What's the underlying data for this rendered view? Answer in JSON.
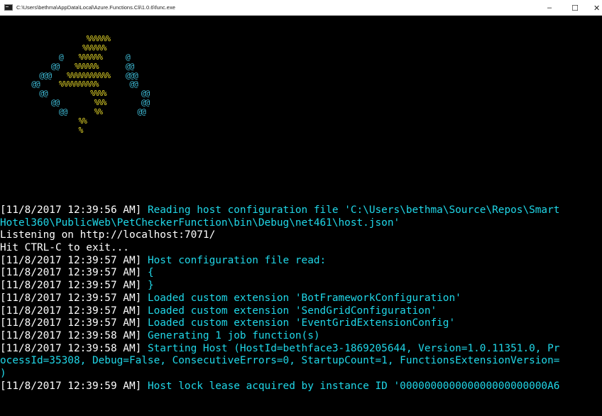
{
  "window": {
    "title": "C:\\Users\\bethma\\AppData\\Local\\Azure.Functions.Cli\\1.0.6\\func.exe",
    "minimize_glyph": "–",
    "maximize_glyph": "☐",
    "close_glyph": "✕"
  },
  "logo": [
    {
      "pad": "                      ",
      "at_left": "",
      "gap": "",
      "pct": "%%%%%%",
      "gap2": "",
      "at_right": ""
    },
    {
      "pad": "                     ",
      "at_left": "",
      "gap": "",
      "pct": "%%%%%%",
      "gap2": "",
      "at_right": ""
    },
    {
      "pad": "               ",
      "at_left": "@",
      "gap": "    ",
      "pct": "%%%%%%",
      "gap2": "      ",
      "at_right": "@"
    },
    {
      "pad": "             ",
      "at_left": "@@",
      "gap": "    ",
      "pct": "%%%%%%",
      "gap2": "       ",
      "at_right": "@@"
    },
    {
      "pad": "          ",
      "at_left": "@@@",
      "gap": "    ",
      "pct": "%%%%%%%%%%%",
      "gap2": "    ",
      "at_right": "@@@"
    },
    {
      "pad": "        ",
      "at_left": "@@",
      "gap": "     ",
      "pct": "%%%%%%%%%%",
      "gap2": "        ",
      "at_right": "@@"
    },
    {
      "pad": "          ",
      "at_left": "@@",
      "gap": "           ",
      "pct": "%%%%",
      "gap2": "         ",
      "at_right": "@@"
    },
    {
      "pad": "             ",
      "at_left": "@@",
      "gap": "         ",
      "pct": "%%%",
      "gap2": "         ",
      "at_right": "@@"
    },
    {
      "pad": "               ",
      "at_left": "@@",
      "gap": "       ",
      "pct": "%%",
      "gap2": "         ",
      "at_right": "@@"
    },
    {
      "pad": "                    ",
      "at_left": "",
      "gap": "",
      "pct": "%%",
      "gap2": "",
      "at_right": ""
    },
    {
      "pad": "                    ",
      "at_left": "",
      "gap": "",
      "pct": "%",
      "gap2": "",
      "at_right": ""
    }
  ],
  "log": [
    {
      "ts": "[11/8/2017 12:39:56 AM]",
      "msg": " Reading host configuration file 'C:\\Users\\bethma\\Source\\Repos\\Smart"
    },
    {
      "ts": "",
      "msg": "Hotel360\\PublicWeb\\PetCheckerFunction\\bin\\Debug\\net461\\host.json'"
    },
    {
      "ts": "Listening on http://localhost:7071/",
      "msg": ""
    },
    {
      "ts": "Hit CTRL-C to exit...",
      "msg": ""
    },
    {
      "ts": "[11/8/2017 12:39:57 AM]",
      "msg": " Host configuration file read:"
    },
    {
      "ts": "[11/8/2017 12:39:57 AM]",
      "msg": " {"
    },
    {
      "ts": "[11/8/2017 12:39:57 AM]",
      "msg": " }"
    },
    {
      "ts": "[11/8/2017 12:39:57 AM]",
      "msg": " Loaded custom extension 'BotFrameworkConfiguration'"
    },
    {
      "ts": "[11/8/2017 12:39:57 AM]",
      "msg": " Loaded custom extension 'SendGridConfiguration'"
    },
    {
      "ts": "[11/8/2017 12:39:57 AM]",
      "msg": " Loaded custom extension 'EventGridExtensionConfig'"
    },
    {
      "ts": "[11/8/2017 12:39:58 AM]",
      "msg": " Generating 1 job function(s)"
    },
    {
      "ts": "[11/8/2017 12:39:58 AM]",
      "msg": " Starting Host (HostId=bethface3-1869205644, Version=1.0.11351.0, Pr"
    },
    {
      "ts": "",
      "msg": "ocessId=35308, Debug=False, ConsecutiveErrors=0, StartupCount=1, FunctionsExtensionVersion="
    },
    {
      "ts": "",
      "msg": ")"
    },
    {
      "ts": "[11/8/2017 12:39:59 AM]",
      "msg": " Host lock lease acquired by instance ID '000000000000000000000000A6"
    }
  ],
  "colors": {
    "background": "#000000",
    "timestamp": "#ffffff",
    "message": "#20d7e8",
    "logo_at": "#3fbcd7",
    "logo_percent": "#e8da2a"
  }
}
